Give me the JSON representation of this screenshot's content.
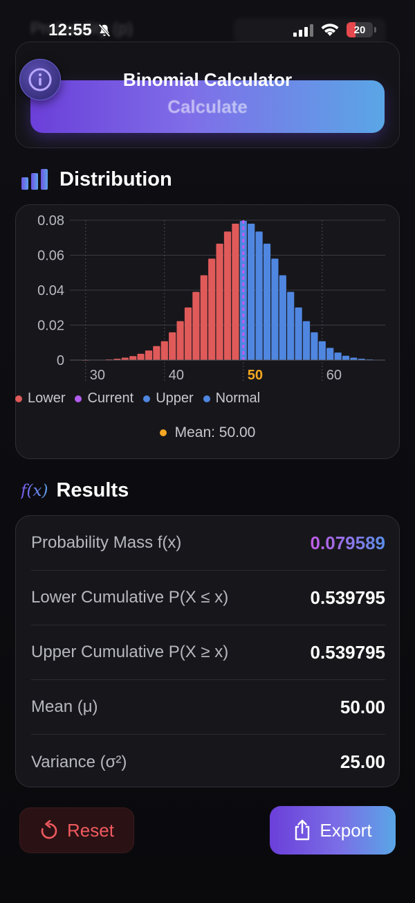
{
  "status_bar": {
    "time": "12:55",
    "battery_level": "20",
    "ghost_text": "Probability (p)"
  },
  "header": {
    "title": "Binomial Calculator",
    "calculate_label": "Calculate",
    "info_icon": "info-icon"
  },
  "distribution": {
    "title": "Distribution",
    "icon": "bar-chart-icon",
    "legend": [
      {
        "label": "Lower",
        "color": "#e05a5a"
      },
      {
        "label": "Current",
        "color": "#b35cf0"
      },
      {
        "label": "Upper",
        "color": "#4f86e0"
      },
      {
        "label": "Normal",
        "color": "#4f86e0"
      }
    ],
    "mean_label": "Mean: 50.00",
    "mean_color": "#f5a623"
  },
  "chart_data": {
    "type": "bar",
    "x_ticks": [
      "30",
      "40",
      "50",
      "60"
    ],
    "y_ticks": [
      "0",
      "0.02",
      "0.04",
      "0.06",
      "0.08"
    ],
    "highlight_tick": "50",
    "xlim": [
      28,
      68
    ],
    "ylim": [
      0,
      0.08
    ],
    "current_x": 50,
    "series": [
      {
        "name": "Lower",
        "x": [
          30,
          31,
          32,
          33,
          34,
          35,
          36,
          37,
          38,
          39,
          40,
          41,
          42,
          43,
          44,
          45,
          46,
          47,
          48,
          49
        ],
        "values": [
          0.0,
          0.0001,
          0.0002,
          0.0004,
          0.0008,
          0.0014,
          0.0023,
          0.0036,
          0.0055,
          0.008,
          0.0108,
          0.0159,
          0.0223,
          0.0301,
          0.039,
          0.0485,
          0.058,
          0.0666,
          0.0735,
          0.078
        ]
      },
      {
        "name": "Current",
        "x": [
          50
        ],
        "values": [
          0.0796
        ]
      },
      {
        "name": "Upper",
        "x": [
          51,
          52,
          53,
          54,
          55,
          56,
          57,
          58,
          59,
          60,
          61,
          62,
          63,
          64,
          65,
          66,
          67
        ],
        "values": [
          0.078,
          0.0735,
          0.0666,
          0.058,
          0.0485,
          0.039,
          0.0301,
          0.0223,
          0.0159,
          0.0108,
          0.007,
          0.0043,
          0.0025,
          0.0014,
          0.0008,
          0.0004,
          0.0002
        ]
      }
    ],
    "colors": {
      "lower": "#e05a5a",
      "upper": "#4f86e0",
      "current": "#c25cf5"
    }
  },
  "results": {
    "title": "Results",
    "icon": "function-icon",
    "icon_text": "ƒ(x)",
    "rows": [
      {
        "label": "Probability Mass f(x)",
        "value": "0.079589"
      },
      {
        "label": "Lower Cumulative P(X ≤ x)",
        "value": "0.539795"
      },
      {
        "label": "Upper Cumulative P(X ≥ x)",
        "value": "0.539795"
      },
      {
        "label": "Mean (μ)",
        "value": "50.00"
      },
      {
        "label": "Variance (σ²)",
        "value": "25.00"
      }
    ]
  },
  "actions": {
    "reset_label": "Reset",
    "export_label": "Export"
  }
}
